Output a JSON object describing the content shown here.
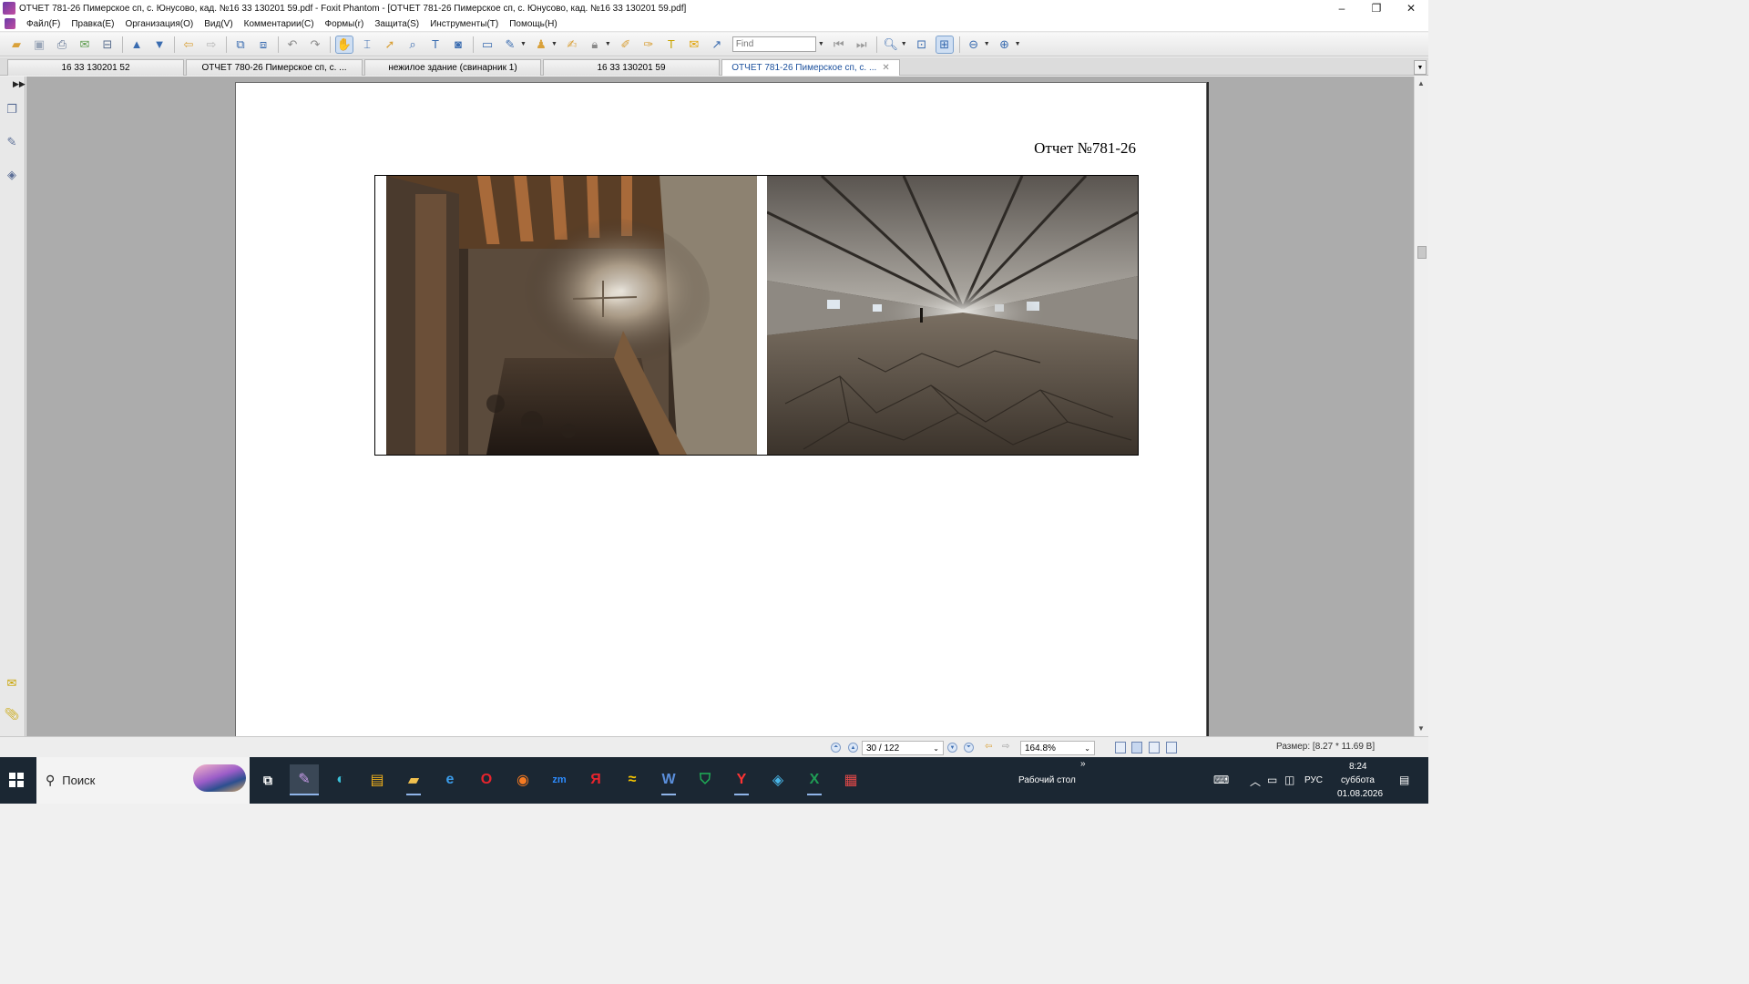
{
  "window": {
    "title": "ОТЧЕТ 781-26 Пимерское сп, с. Юнусово, кад. №16 33 130201 59.pdf - Foxit Phantom - [ОТЧЕТ 781-26 Пимерское сп, с. Юнусово, кад. №16 33 130201 59.pdf]",
    "minimize": "–",
    "restore": "❐",
    "close": "✕"
  },
  "menu": [
    "Файл(F)",
    "Правка(E)",
    "Организация(O)",
    "Вид(V)",
    "Комментарии(C)",
    "Формы(r)",
    "Защита(S)",
    "Инструменты(T)",
    "Помощь(H)"
  ],
  "toolbar": {
    "find_placeholder": "Find",
    "icons": [
      "open-icon",
      "save-icon",
      "print-icon",
      "email-icon",
      "scan-icon",
      "page-up-icon",
      "page-down-icon",
      "back-icon",
      "forward-icon",
      "insert-pages-icon",
      "extract-pages-icon",
      "undo-icon",
      "redo-icon",
      "hand-tool-icon",
      "select-text-icon",
      "select-object-icon",
      "snapshot-icon",
      "typewriter-icon",
      "camera-icon",
      "rectangle-icon",
      "edit-icon",
      "stamp-icon",
      "sign-icon",
      "lock-icon",
      "highlight-icon",
      "note-edit-icon",
      "textbox-icon",
      "comment-icon",
      "arrow-icon",
      "zoom-in-icon",
      "fit-page-icon",
      "fit-width-icon",
      "zoom-out-icon",
      "zoom-plus-icon"
    ]
  },
  "tabs": [
    {
      "label": "16 33 130201 52",
      "active": false
    },
    {
      "label": "ОТЧЕТ 780-26 Пимерское сп, с. ...",
      "active": false
    },
    {
      "label": "нежилое здание (свинарник 1)",
      "active": false
    },
    {
      "label": "16 33 130201 59",
      "active": false
    },
    {
      "label": "ОТЧЕТ 781-26 Пимерское сп, с. ...",
      "active": true,
      "close": "✕"
    }
  ],
  "document": {
    "report_title": "Отчет №781-26",
    "photos": [
      "interior-attic-photo",
      "barn-interior-photo"
    ]
  },
  "statusbar": {
    "page_value": "30 / 122",
    "zoom_value": "164.8%",
    "size_label": "Размер: [8.27 * 11.69 В]"
  },
  "taskbar": {
    "search_label": "Поиск",
    "desktop_label": "Рабочий стол",
    "language": "РУС",
    "time": "8:24",
    "day": "суббота",
    "date": "01.08.2026",
    "overflow": "»",
    "apps": [
      "foxit-phantom",
      "edge",
      "outlook",
      "file-explorer",
      "internet-explorer",
      "opera",
      "firefox",
      "zoom",
      "yandex",
      "beeline",
      "word",
      "kaspersky",
      "yandex-browser",
      "app-blue",
      "excel",
      "red-app"
    ]
  },
  "colors": {
    "accent": "#3a6cb0",
    "taskbar": "#1b2733",
    "doc_background": "#acacac"
  }
}
